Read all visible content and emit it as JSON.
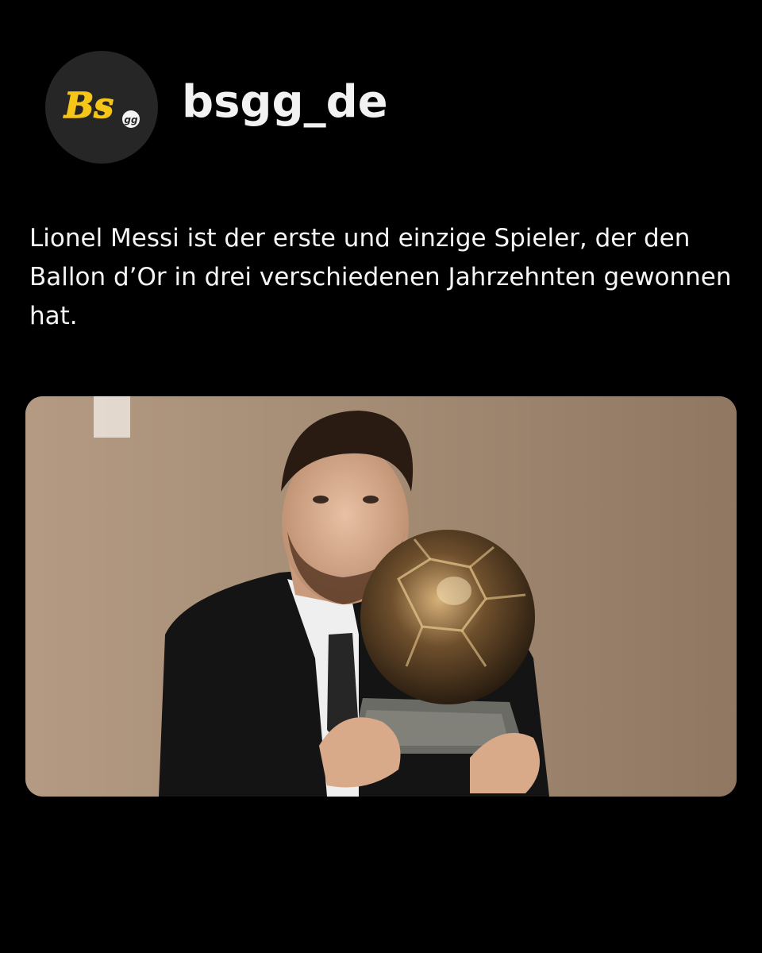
{
  "profile": {
    "username": "bsgg_de",
    "avatar_logo_text": "Bs",
    "avatar_logo_subtext": "gg"
  },
  "post": {
    "caption": "Lionel Messi ist der erste und einzige Spieler, der den Ballon d’Or in drei verschiedenen Jahrzehnten gewonnen hat.",
    "image_icon": "photo-icon"
  },
  "colors": {
    "background": "#000000",
    "avatar_bg": "#262626",
    "logo_yellow": "#f5c518",
    "text": "#f5f5f5"
  }
}
